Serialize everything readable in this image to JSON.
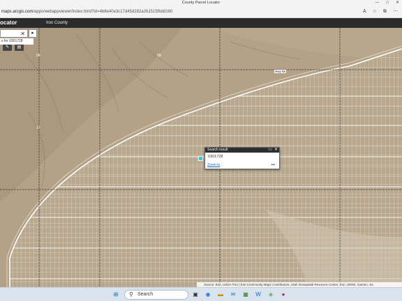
{
  "browser": {
    "window_title": "County Parcel Locator",
    "url_host": "maps.arcgis.com",
    "url_path": "/apps/webappviewer/index.html?id=4b8e40e3c17d45d282a2b1515fbdd160",
    "minimize": "—",
    "maximize": "□",
    "close": "✕"
  },
  "app": {
    "title": "ocator",
    "subtitle": "Iron County"
  },
  "search": {
    "value": "",
    "clear_label": "✕",
    "go_label": "▸",
    "suggestion": "s for 0301728"
  },
  "map": {
    "section_labels": [
      "08",
      "09",
      "17"
    ],
    "road_label": "Hwy 56"
  },
  "popup": {
    "title": "Search result",
    "result": "0301728",
    "zoom_label": "Zoom to",
    "more_label": "•••"
  },
  "attribution": "Source: Esri, USDA FSA | Esri Community Maps Contributors, Utah Geospatial Resource Center, Esri, HERE, Garmin, Sa",
  "taskbar": {
    "search_placeholder": "Search"
  },
  "colors": {
    "header_bg": "#2b2b2b",
    "map_bg": "#b3a288",
    "marker": "#38c7e0",
    "parcel_line": "#ffffff"
  }
}
